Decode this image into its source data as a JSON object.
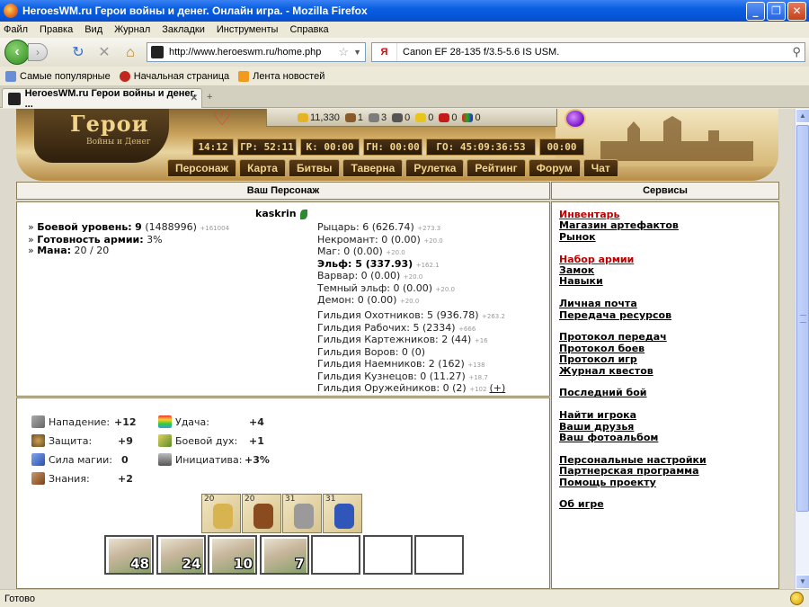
{
  "window": {
    "title": "HeroesWM.ru Герои войны и денег. Онлайн игра. - Mozilla Firefox"
  },
  "menu": [
    "Файл",
    "Правка",
    "Вид",
    "Журнал",
    "Закладки",
    "Инструменты",
    "Справка"
  ],
  "address": {
    "url": "http://www.heroeswm.ru/home.php",
    "search_text": "Canon EF 28-135 f/3.5-5.6 IS USM.",
    "search_engine": "Я"
  },
  "bookmarks": [
    "Самые популярные",
    "Начальная страница",
    "Лента новостей"
  ],
  "tab": {
    "title": "HeroesWM.ru Герои войны и денег. ...",
    "new_tab": "+"
  },
  "banner": {
    "logo": "Герои",
    "logo_sub": "Войны и Денег",
    "resources": [
      "11,330",
      "1",
      "3",
      "0",
      "0",
      "0",
      "0"
    ],
    "times": [
      "14:12",
      "ГР: 52:11",
      "К: 00:00",
      "ГН: 00:00",
      "ГО: 45:09:36:53",
      "00:00"
    ],
    "nav": [
      "Персонаж",
      "Карта",
      "Битвы",
      "Таверна",
      "Рулетка",
      "Рейтинг",
      "Форум",
      "Чат"
    ]
  },
  "character": {
    "heading": "Ваш Персонаж",
    "name": "kaskrin",
    "left_lines": [
      {
        "label": "Боевой уровень:",
        "value": "9",
        "extra": "(1488996)",
        "small": "+161004"
      },
      {
        "label": "Готовность армии:",
        "value": "3%",
        "extra": "",
        "small": ""
      },
      {
        "label": "Мана:",
        "value": "20 / 20",
        "extra": "",
        "small": ""
      }
    ],
    "factions": [
      {
        "text": "Рыцарь: 6 (626.74)",
        "small": "+273.3",
        "bold": false
      },
      {
        "text": "Некромант: 0 (0.00)",
        "small": "+20.0",
        "bold": false
      },
      {
        "text": "Маг: 0 (0.00)",
        "small": "+20.0",
        "bold": false
      },
      {
        "text": "Эльф: 5 (337.93)",
        "small": "+162.1",
        "bold": true
      },
      {
        "text": "Варвар: 0 (0.00)",
        "small": "+20.0",
        "bold": false
      },
      {
        "text": "Темный эльф: 0 (0.00)",
        "small": "+20.0",
        "bold": false
      },
      {
        "text": "Демон: 0 (0.00)",
        "small": "+20.0",
        "bold": false
      }
    ],
    "guilds": [
      {
        "text": "Гильдия Охотников: 5 (936.78)",
        "small": "+263.2"
      },
      {
        "text": "Гильдия Рабочих: 5 (2334)",
        "small": "+666"
      },
      {
        "text": "Гильдия Картежников: 2 (44)",
        "small": "+16"
      },
      {
        "text": "Гильдия Воров: 0 (0)",
        "small": ""
      },
      {
        "text": "Гильдия Наемников: 2 (162)",
        "small": "+138"
      },
      {
        "text": "Гильдия Кузнецов: 0 (11.27)",
        "small": "+18.7"
      },
      {
        "text": "Гильдия Оружейников: 0 (2)",
        "small": "+102"
      }
    ],
    "guild_plus": "(+)"
  },
  "stats": {
    "attack_label": "Нападение:",
    "attack": "+12",
    "defense_label": "Защита:",
    "defense": "+9",
    "spell_label": "Сила магии:",
    "spell": "0",
    "knowledge_label": "Знания:",
    "knowledge": "+2",
    "luck_label": "Удача:",
    "luck": "+4",
    "morale_label": "Боевой дух:",
    "morale": "+1",
    "initiative_label": "Инициатива:",
    "initiative": "+3%"
  },
  "artifacts": [
    {
      "level": "20",
      "name": "amulet-icon",
      "color": "#d8b451"
    },
    {
      "level": "20",
      "name": "armor-icon",
      "color": "#8a4b1f"
    },
    {
      "level": "31",
      "name": "sword-icon",
      "color": "#9a9a9a"
    },
    {
      "level": "31",
      "name": "shield-icon",
      "color": "#2f56b8"
    }
  ],
  "army": [
    "48",
    "24",
    "10",
    "7",
    "",
    "",
    ""
  ],
  "services": {
    "heading": "Сервисы",
    "groups": [
      [
        {
          "label": "Инвентарь",
          "red": true
        },
        {
          "label": "Магазин артефактов"
        },
        {
          "label": "Рынок"
        }
      ],
      [
        {
          "label": "Набор армии",
          "red": true
        },
        {
          "label": "Замок"
        },
        {
          "label": "Навыки"
        }
      ],
      [
        {
          "label": "Личная почта"
        },
        {
          "label": "Передача ресурсов"
        }
      ],
      [
        {
          "label": "Протокол передач"
        },
        {
          "label": "Протокол боев"
        },
        {
          "label": "Протокол игр"
        },
        {
          "label": "Журнал квестов"
        }
      ],
      [
        {
          "label": "Последний бой"
        }
      ],
      [
        {
          "label": "Найти игрока"
        },
        {
          "label": "Ваши друзья"
        },
        {
          "label": "Ваш фотоальбом"
        }
      ],
      [
        {
          "label": "Персональные настройки"
        },
        {
          "label": "Партнерская программа"
        },
        {
          "label": "Помощь проекту"
        }
      ],
      [
        {
          "label": "Об игре"
        }
      ]
    ]
  },
  "status": {
    "text": "Готово"
  }
}
